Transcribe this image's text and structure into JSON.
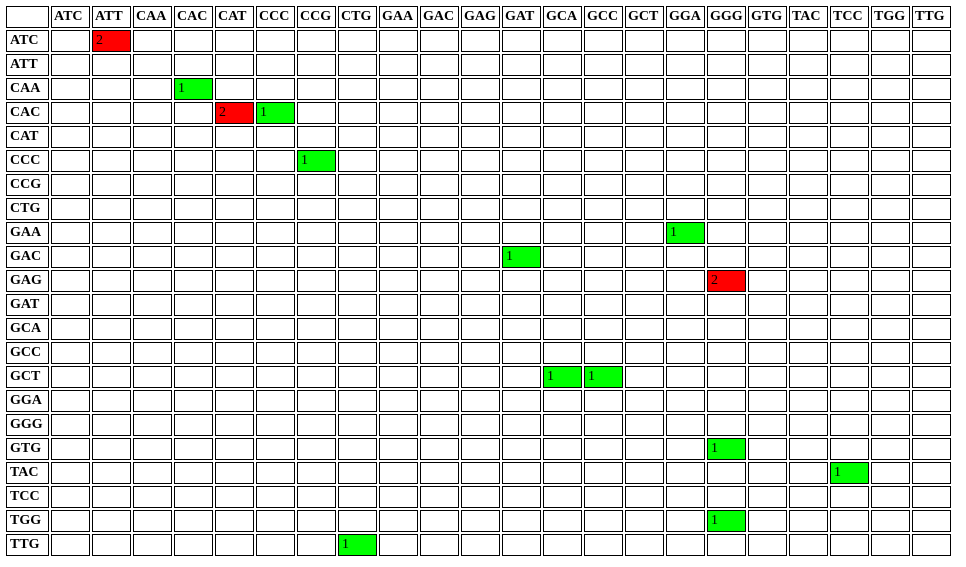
{
  "columns": [
    "ATC",
    "ATT",
    "CAA",
    "CAC",
    "CAT",
    "CCC",
    "CCG",
    "CTG",
    "GAA",
    "GAC",
    "GAG",
    "GAT",
    "GCA",
    "GCC",
    "GCT",
    "GGA",
    "GGG",
    "GTG",
    "TAC",
    "TCC",
    "TGG",
    "TTG"
  ],
  "rows": [
    "ATC",
    "ATT",
    "CAA",
    "CAC",
    "CAT",
    "CCC",
    "CCG",
    "CTG",
    "GAA",
    "GAC",
    "GAG",
    "GAT",
    "GCA",
    "GCC",
    "GCT",
    "GGA",
    "GGG",
    "GTG",
    "TAC",
    "TCC",
    "TGG",
    "TTG"
  ],
  "cells": {
    "ATC": {
      "ATT": {
        "value": "2",
        "color": "red"
      }
    },
    "CAA": {
      "CAC": {
        "value": "1",
        "color": "green"
      }
    },
    "CAC": {
      "CAT": {
        "value": "2",
        "color": "red"
      },
      "CCC": {
        "value": "1",
        "color": "green"
      }
    },
    "CCC": {
      "CCG": {
        "value": "1",
        "color": "green"
      }
    },
    "GAA": {
      "GGA": {
        "value": "1",
        "color": "green"
      }
    },
    "GAC": {
      "GAT": {
        "value": "1",
        "color": "green"
      }
    },
    "GAG": {
      "GGG": {
        "value": "2",
        "color": "red"
      }
    },
    "GCT": {
      "GCA": {
        "value": "1",
        "color": "green"
      },
      "GCC": {
        "value": "1",
        "color": "green"
      }
    },
    "GTG": {
      "GGG": {
        "value": "1",
        "color": "green"
      }
    },
    "TAC": {
      "TCC": {
        "value": "1",
        "color": "green"
      }
    },
    "TGG": {
      "GGG": {
        "value": "1",
        "color": "green"
      }
    },
    "TTG": {
      "CTG": {
        "value": "1",
        "color": "green"
      }
    }
  }
}
